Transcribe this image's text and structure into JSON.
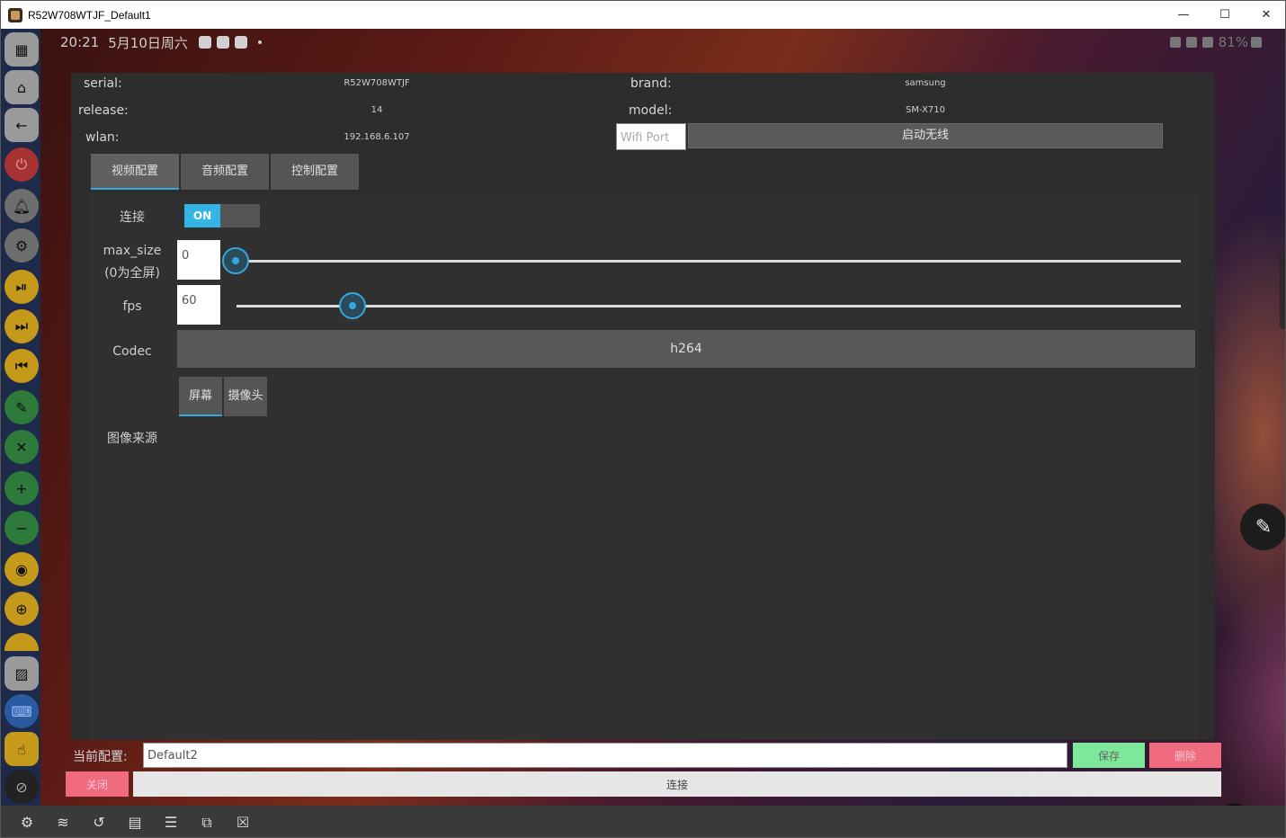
{
  "window": {
    "title": "R52W708WTJF_Default1",
    "controls": {
      "minimize": "—",
      "maximize": "☐",
      "close": "✕"
    }
  },
  "statusbar": {
    "time": "20:21",
    "date": "5月10日周六",
    "battery": "81%"
  },
  "sidebar": {
    "buttons": [
      {
        "name": "apps-grid-icon",
        "glyph": "▦"
      },
      {
        "name": "home-icon",
        "glyph": "⌂"
      },
      {
        "name": "back-arrow-icon",
        "glyph": "←"
      },
      {
        "name": "power-icon",
        "glyph": "⏻"
      },
      {
        "name": "notification-bell-icon",
        "glyph": "♪"
      },
      {
        "name": "settings-gear-icon",
        "glyph": "⚙"
      },
      {
        "name": "play-pause-icon",
        "glyph": "⏯"
      },
      {
        "name": "next-track-icon",
        "glyph": "⏭"
      },
      {
        "name": "previous-track-icon",
        "glyph": "⏮"
      },
      {
        "name": "mic-off-icon",
        "glyph": "✎"
      },
      {
        "name": "volume-mute-icon",
        "glyph": "✕"
      },
      {
        "name": "volume-up-icon",
        "glyph": "+"
      },
      {
        "name": "volume-down-icon",
        "glyph": "−"
      },
      {
        "name": "camera-icon",
        "glyph": "◉"
      },
      {
        "name": "zoom-in-icon",
        "glyph": "⊕"
      }
    ]
  },
  "device_info": {
    "serial_label": "serial:",
    "serial_value": "R52W708WTJF",
    "brand_label": "brand:",
    "brand_value": "samsung",
    "release_label": "release:",
    "release_value": "14",
    "model_label": "model:",
    "model_value": "SM-X710",
    "wlan_label": "wlan:",
    "wlan_value": "192.168.6.107",
    "wifi_port_placeholder": "Wifi Port",
    "wifi_start_button": "启动无线"
  },
  "tabs": [
    {
      "label": "视频配置",
      "active": true
    },
    {
      "label": "音频配置",
      "active": false
    },
    {
      "label": "控制配置",
      "active": false
    }
  ],
  "video_config": {
    "connect_label": "连接",
    "toggle_text": "ON",
    "max_size_label": "max_size",
    "max_size_hint": "(0为全屏)",
    "max_size_value": "0",
    "fps_label": "fps",
    "fps_value": "60",
    "codec_label": "Codec",
    "codec_value": "h264",
    "source_label": "图像来源",
    "source_options": [
      "屏幕",
      "摄像头"
    ]
  },
  "footer": {
    "current_config_label": "当前配置:",
    "current_config_value": "Default2",
    "save_button": "保存",
    "delete_button": "删除",
    "close_button": "关闭",
    "connect_button": "连接"
  },
  "colors": {
    "accent": "#33a8e0",
    "save": "#7ee89a",
    "danger": "#f06a80"
  }
}
